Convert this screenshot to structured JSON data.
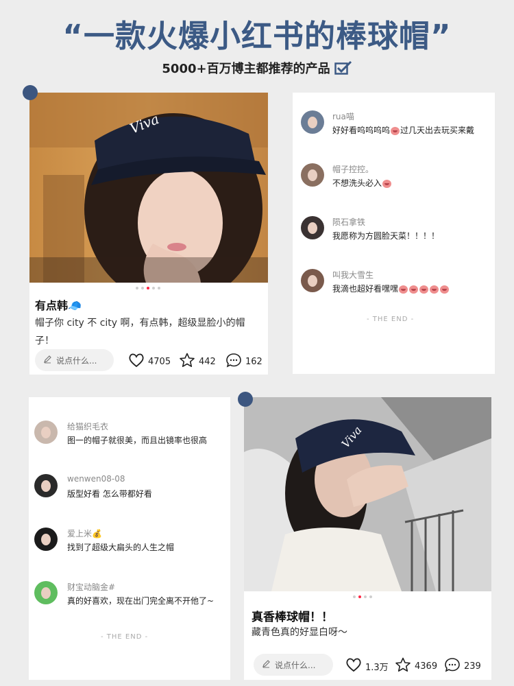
{
  "header": {
    "title": "“一款火爆小红书的棒球帽”",
    "subtitle": "5000+百万博主都推荐的产品"
  },
  "colors": {
    "accent": "#3c5a85",
    "marker": "#3c5680",
    "active_dot": "#ff2442"
  },
  "post1": {
    "title": "有点韩🧢",
    "desc_line1": "帽子你 city 不 city 啊，有点韩，超级显脸小的帽",
    "desc_line2": "子！",
    "input_placeholder": "说点什么...",
    "likes": "4705",
    "collects": "442",
    "comments": "162",
    "image_pages": 5,
    "image_current": 3
  },
  "comments1": [
    {
      "name": "rua喵",
      "text": "好好看呜呜呜呜",
      "emoji_count": 1,
      "text_after": "过几天出去玩买来戴"
    },
    {
      "name": "帽子控控。",
      "text": "不想洗头必入",
      "emoji_count": 1,
      "text_after": ""
    },
    {
      "name": "陨石拿铁",
      "text": "我愿称为方圆脸天菜！！！！",
      "emoji_count": 0,
      "text_after": ""
    },
    {
      "name": "叫我大雪生",
      "text": "我滴也超好看嘿嘿",
      "emoji_count": 5,
      "text_after": ""
    }
  ],
  "comments1_end": "- THE END -",
  "comments2": [
    {
      "name": "给猫织毛衣",
      "text": "图一的帽子就很美，而且出镜率也很高",
      "emoji_count": 0,
      "text_after": ""
    },
    {
      "name": "wenwen08-08",
      "text": "版型好看 怎么带都好看",
      "emoji_count": 0,
      "text_after": ""
    },
    {
      "name": "爱上米💰",
      "text": "找到了超级大扁头的人生之帽",
      "emoji_count": 0,
      "text_after": ""
    },
    {
      "name": "财宝动脑金#",
      "text": "真的好喜欢，现在出门完全离不开他了~",
      "emoji_count": 0,
      "text_after": ""
    }
  ],
  "comments2_end": "- THE END -",
  "post2": {
    "title": "真香棒球帽！！",
    "desc": "藏青色真的好显白呀～",
    "input_placeholder": "说点什么...",
    "likes": "1.3万",
    "collects": "4369",
    "comments": "239",
    "image_pages": 4,
    "image_current": 2
  },
  "icons": [
    "check-box-icon",
    "pen-icon",
    "heart-icon",
    "star-icon",
    "comment-bubble-icon"
  ]
}
